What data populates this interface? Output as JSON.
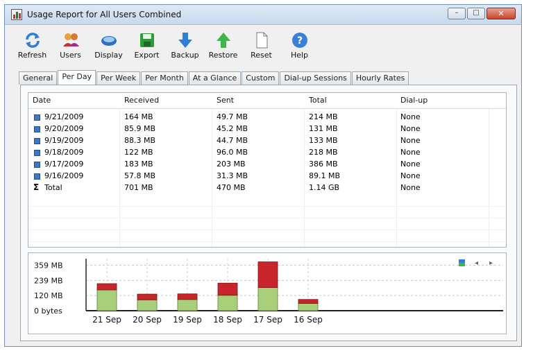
{
  "window": {
    "title": "Usage Report for All Users Combined"
  },
  "caption_buttons": {
    "minimize": "–",
    "maximize": "□",
    "close": "✕"
  },
  "toolbar": [
    {
      "key": "refresh",
      "label": "Refresh",
      "icon": "refresh-icon"
    },
    {
      "key": "users",
      "label": "Users",
      "icon": "users-icon"
    },
    {
      "key": "display",
      "label": "Display",
      "icon": "display-icon"
    },
    {
      "key": "export",
      "label": "Export",
      "icon": "export-icon"
    },
    {
      "key": "backup",
      "label": "Backup",
      "icon": "backup-arrow-icon"
    },
    {
      "key": "restore",
      "label": "Restore",
      "icon": "restore-arrow-icon"
    },
    {
      "key": "reset",
      "label": "Reset",
      "icon": "reset-document-icon"
    },
    {
      "key": "help",
      "label": "Help",
      "icon": "help-icon"
    }
  ],
  "tabs": [
    {
      "label": "General",
      "active": false
    },
    {
      "label": "Per Day",
      "active": true
    },
    {
      "label": "Per Week",
      "active": false
    },
    {
      "label": "Per Month",
      "active": false
    },
    {
      "label": "At a Glance",
      "active": false
    },
    {
      "label": "Custom",
      "active": false
    },
    {
      "label": "Dial-up Sessions",
      "active": false
    },
    {
      "label": "Hourly Rates",
      "active": false
    }
  ],
  "table": {
    "columns": [
      "Date",
      "Received",
      "Sent",
      "Total",
      "Dial-up"
    ],
    "rows": [
      {
        "date": "9/21/2009",
        "received": "164 MB",
        "sent": "49.7 MB",
        "total": "214 MB",
        "dialup": "None"
      },
      {
        "date": "9/20/2009",
        "received": "85.9 MB",
        "sent": "45.2 MB",
        "total": "131 MB",
        "dialup": "None"
      },
      {
        "date": "9/19/2009",
        "received": "88.3 MB",
        "sent": "44.7 MB",
        "total": "133 MB",
        "dialup": "None"
      },
      {
        "date": "9/18/2009",
        "received": "122 MB",
        "sent": "96.0 MB",
        "total": "218 MB",
        "dialup": "None"
      },
      {
        "date": "9/17/2009",
        "received": "183 MB",
        "sent": "203 MB",
        "total": "386 MB",
        "dialup": "None"
      },
      {
        "date": "9/16/2009",
        "received": "57.8 MB",
        "sent": "31.3 MB",
        "total": "89.1 MB",
        "dialup": "None"
      }
    ],
    "total_row": {
      "symbol": "Σ",
      "date": "Total",
      "received": "701 MB",
      "sent": "470 MB",
      "total": "1.14 GB",
      "dialup": "None"
    }
  },
  "chart_controls": {
    "prev": "◂",
    "next": "▸"
  },
  "chart_data": {
    "type": "bar",
    "stacked": true,
    "categories": [
      "21 Sep",
      "20 Sep",
      "19 Sep",
      "18 Sep",
      "17 Sep",
      "16 Sep"
    ],
    "series": [
      {
        "key": "received",
        "values": [
          164,
          85.9,
          88.3,
          122,
          183,
          57.8
        ],
        "color": "#a8d07a"
      },
      {
        "key": "sent",
        "values": [
          49.7,
          45.2,
          44.7,
          96.0,
          203,
          31.3
        ],
        "color": "#c8242b"
      }
    ],
    "yticks": [
      "0 bytes",
      "120 MB",
      "239 MB",
      "359 MB"
    ],
    "ytick_values": [
      0,
      120,
      239,
      359
    ],
    "ylim": [
      0,
      400
    ],
    "grid": true
  }
}
